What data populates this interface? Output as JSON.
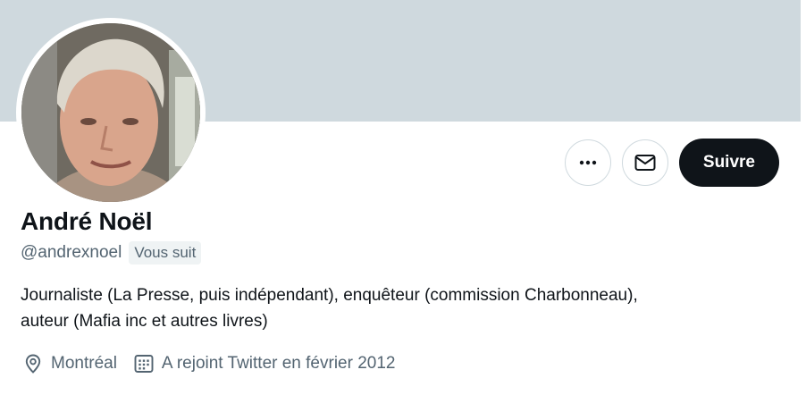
{
  "profile": {
    "display_name": "André Noël",
    "handle": "@andrexnoel",
    "follows_you_badge": "Vous suit",
    "bio_line1": "Journaliste (La Presse, puis indépendant), enquêteur (commission Charbonneau),",
    "bio_line2": "auteur (Mafia inc et autres livres)",
    "location": "Montréal",
    "joined": "A rejoint Twitter en février 2012"
  },
  "actions": {
    "more_icon": "more-horizontal-icon",
    "message_icon": "envelope-icon",
    "follow_label": "Suivre"
  },
  "colors": {
    "banner": "#cfd9de",
    "follow_button": "#0f1419",
    "secondary_text": "#536471",
    "badge_bg": "#eff3f4"
  }
}
